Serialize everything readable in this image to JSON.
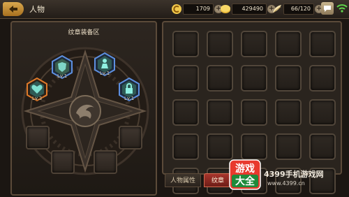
{
  "header": {
    "title": "人物",
    "resources": [
      {
        "name": "crystal",
        "value": "1709"
      },
      {
        "name": "gold",
        "value": "429490"
      },
      {
        "name": "stamina",
        "value": "66/120"
      }
    ]
  },
  "emblem_panel": {
    "title": "纹章装备区",
    "equipped": [
      {
        "name": "emblem-shield",
        "level": "Lv.1"
      },
      {
        "name": "emblem-figure",
        "level": "Lv.1"
      },
      {
        "name": "emblem-heart",
        "level": "Lv.3"
      },
      {
        "name": "emblem-lock",
        "level": "Lv.1"
      }
    ]
  },
  "tabs": [
    {
      "label": "人物属性",
      "active": false
    },
    {
      "label": "纹章",
      "active": true
    }
  ],
  "watermark": {
    "badge_top": "游戏",
    "badge_bottom": "大全",
    "site": "4399手机游戏网",
    "url": "www.4399.cn"
  },
  "colors": {
    "accent_orange": "#d9a84e",
    "badge_blue": "#2f6fd4",
    "badge_orange": "#e07a2a",
    "active_tab": "#a7352c"
  }
}
